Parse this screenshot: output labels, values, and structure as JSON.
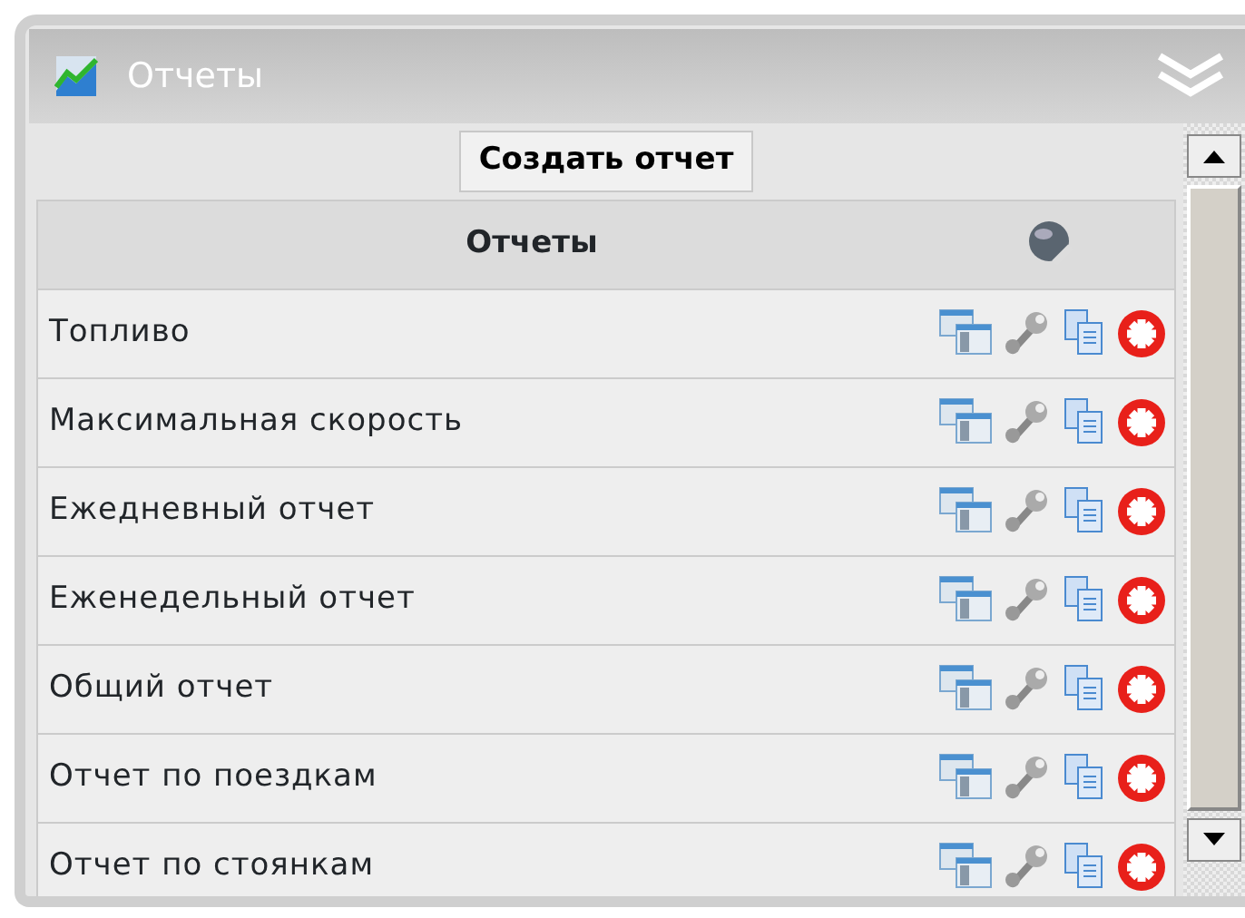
{
  "panel": {
    "title": "Отчеты"
  },
  "create_button": "Создать отчет",
  "table": {
    "columns": [
      "Отчеты"
    ],
    "rows": [
      {
        "name": "Топливо"
      },
      {
        "name": "Максимальная скорость"
      },
      {
        "name": "Ежедневный отчет"
      },
      {
        "name": "Еженедельный отчет"
      },
      {
        "name": "Общий отчет"
      },
      {
        "name": "Отчет по поездкам"
      },
      {
        "name": "Отчет по стоянкам"
      }
    ]
  }
}
